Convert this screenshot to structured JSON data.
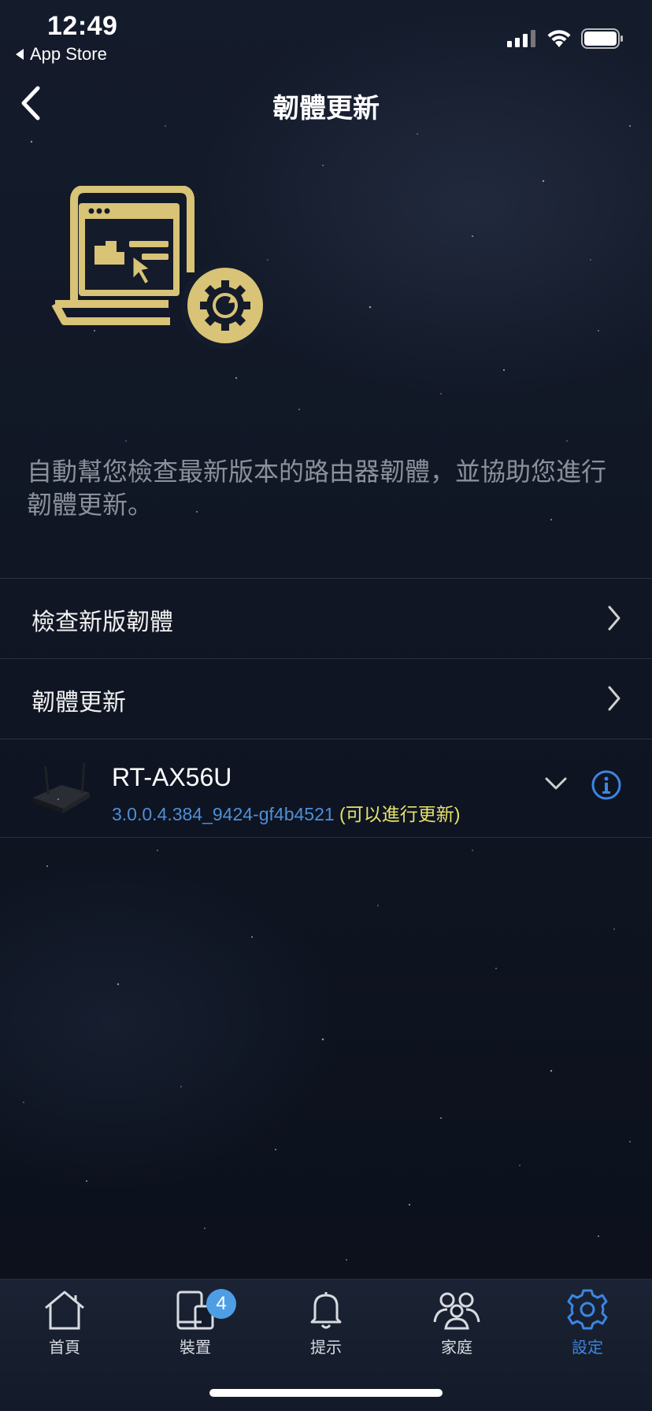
{
  "status_bar": {
    "time": "12:49",
    "back_app": "App Store"
  },
  "nav": {
    "title": "韌體更新",
    "back_icon": "chevron-left-icon"
  },
  "hero": {
    "icon": "firmware-update-illustration",
    "accent_color": "#d8c376"
  },
  "description": "自動幫您檢查最新版本的路由器韌體，並協助您進行韌體更新。",
  "menu": {
    "check_new_firmware": "檢查新版韌體",
    "firmware_update": "韌體更新"
  },
  "device": {
    "name": "RT-AX56U",
    "firmware_version": "3.0.0.4.384_9424-gf4b4521",
    "update_status": " (可以進行更新)",
    "icons": [
      "router-icon",
      "chevron-down-icon",
      "info-icon"
    ]
  },
  "tabs": [
    {
      "label": "首頁",
      "icon": "home-icon"
    },
    {
      "label": "裝置",
      "icon": "devices-icon",
      "badge": "4"
    },
    {
      "label": "提示",
      "icon": "bell-icon"
    },
    {
      "label": "家庭",
      "icon": "family-icon"
    },
    {
      "label": "設定",
      "icon": "gear-icon",
      "active": true
    }
  ],
  "colors": {
    "accent_blue": "#3c86e2",
    "firmware_version": "#4e8fd6",
    "update_available": "#e6e36a",
    "badge": "#4e9ee6"
  }
}
